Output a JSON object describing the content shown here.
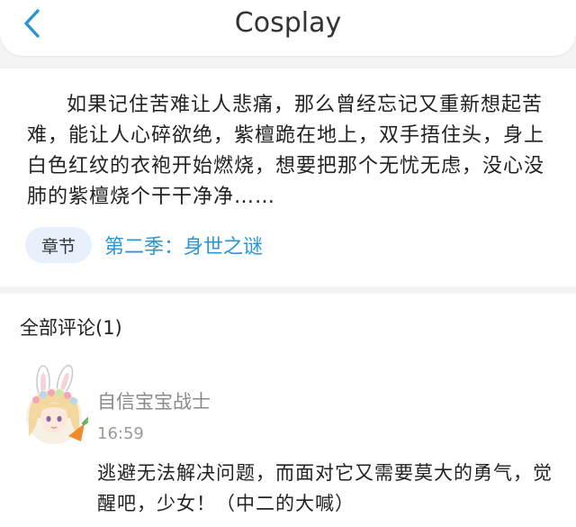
{
  "header": {
    "title": "Cosplay",
    "back_icon": "chevron-left-icon",
    "accent_color": "#2a95d4"
  },
  "synopsis": {
    "text": "如果记住苦难让人悲痛，那么曾经忘记又重新想起苦难，能让人心碎欲绝，紫檀跪在地上，双手捂住头，身上白色红纹的衣袍开始燃烧，想要把那个无忧无虑，没心没肺的紫檀烧个干干净净……",
    "chapter_tag": "章节",
    "chapter_name": "第二季：身世之谜"
  },
  "comments": {
    "heading": "全部评论(1)",
    "items": [
      {
        "username": "自信宝宝战士",
        "time": "16:59",
        "text": "逃避无法解决问题，而面对它又需要莫大的勇气，觉醒吧，少女！（中二的大喊）",
        "avatar_icon": "bunny-girl-avatar"
      }
    ]
  }
}
